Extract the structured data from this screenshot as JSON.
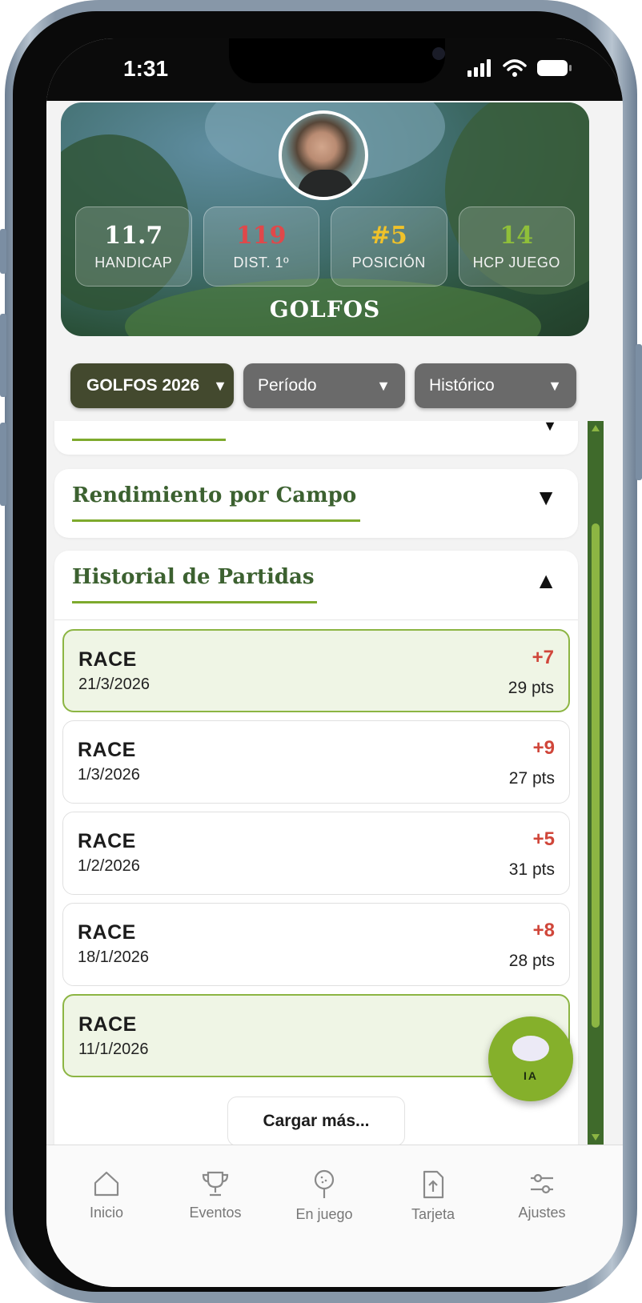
{
  "status_bar": {
    "time": "1:31"
  },
  "header": {
    "title": "GOLFOS",
    "stats": [
      {
        "value": "11.7",
        "label": "HANDICAP",
        "color": "#ffffff"
      },
      {
        "value": "119",
        "label": "DIST. 1º",
        "color": "#e0484a"
      },
      {
        "value": "#5",
        "label": "POSICIÓN",
        "color": "#f0c22a"
      },
      {
        "value": "14",
        "label": "HCP JUEGO",
        "color": "#8fbf3a"
      }
    ]
  },
  "filters": {
    "group": "GOLFOS 2026",
    "period": "Período",
    "history": "Histórico",
    "arrow": "▼"
  },
  "sections": {
    "rendimiento_campo": {
      "title": "Rendimiento por Campo",
      "toggle": "▼"
    },
    "historial": {
      "title": "Historial de Partidas",
      "toggle": "▲"
    },
    "partial_toggle": "▼"
  },
  "matches": [
    {
      "name": "RACE",
      "date": "21/3/2026",
      "score": "+7",
      "points": "29 pts",
      "highlight": true
    },
    {
      "name": "RACE",
      "date": "1/3/2026",
      "score": "+9",
      "points": "27 pts",
      "highlight": false
    },
    {
      "name": "RACE",
      "date": "1/2/2026",
      "score": "+5",
      "points": "31 pts",
      "highlight": false
    },
    {
      "name": "RACE",
      "date": "18/1/2026",
      "score": "+8",
      "points": "28 pts",
      "highlight": false
    },
    {
      "name": "RACE",
      "date": "11/1/2026",
      "score": "",
      "points": "",
      "highlight": true
    }
  ],
  "load_more": "Cargar más...",
  "fab": {
    "label": "IA"
  },
  "tabs": [
    {
      "label": "Inicio",
      "icon": "home-icon"
    },
    {
      "label": "Eventos",
      "icon": "trophy-icon"
    },
    {
      "label": "En juego",
      "icon": "golf-ball-tee-icon"
    },
    {
      "label": "Tarjeta",
      "icon": "upload-file-icon"
    },
    {
      "label": "Ajustes",
      "icon": "sliders-icon"
    }
  ],
  "colors": {
    "accent_green": "#7eaa2d",
    "title_green": "#3c6130",
    "score_red": "#d0463a",
    "scrollbar_green": "#3f6a2b"
  }
}
